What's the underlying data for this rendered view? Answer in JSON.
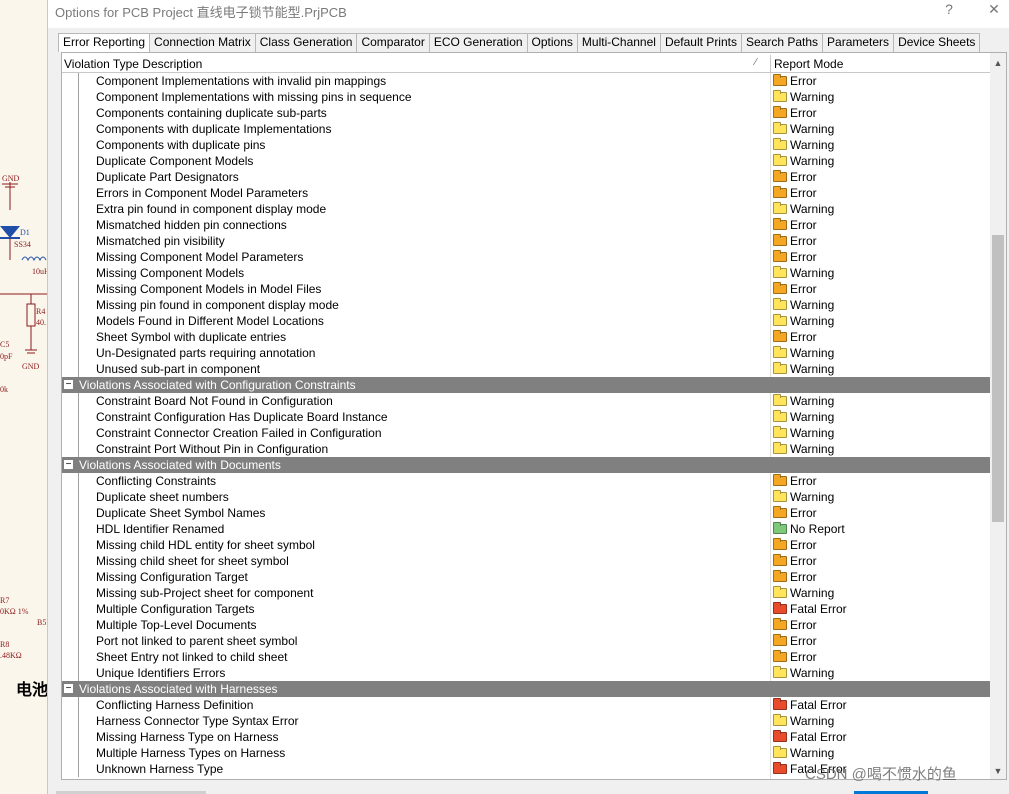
{
  "window": {
    "title": "Options for PCB Project 直线电子锁节能型.PrjPCB",
    "help": "?",
    "close": "✕"
  },
  "tabs": [
    "Error Reporting",
    "Connection Matrix",
    "Class Generation",
    "Comparator",
    "ECO Generation",
    "Options",
    "Multi-Channel",
    "Default Prints",
    "Search Paths",
    "Parameters",
    "Device Sheets"
  ],
  "columns": {
    "description": "Violation Type Description",
    "mode": "Report Mode"
  },
  "mode_colors": {
    "Error": "#f5a623",
    "Warning": "#ffe45c",
    "No Report": "#7ec87a",
    "Fatal Error": "#e84c2a"
  },
  "rows": [
    {
      "kind": "item",
      "text": "Component Implementations with invalid pin mappings",
      "mode": "Error"
    },
    {
      "kind": "item",
      "text": "Component Implementations with missing pins in sequence",
      "mode": "Warning"
    },
    {
      "kind": "item",
      "text": "Components containing duplicate sub-parts",
      "mode": "Error"
    },
    {
      "kind": "item",
      "text": "Components with duplicate Implementations",
      "mode": "Warning"
    },
    {
      "kind": "item",
      "text": "Components with duplicate pins",
      "mode": "Warning"
    },
    {
      "kind": "item",
      "text": "Duplicate Component Models",
      "mode": "Warning"
    },
    {
      "kind": "item",
      "text": "Duplicate Part Designators",
      "mode": "Error"
    },
    {
      "kind": "item",
      "text": "Errors in Component Model Parameters",
      "mode": "Error"
    },
    {
      "kind": "item",
      "text": "Extra pin found in component display mode",
      "mode": "Warning"
    },
    {
      "kind": "item",
      "text": "Mismatched hidden pin connections",
      "mode": "Error"
    },
    {
      "kind": "item",
      "text": "Mismatched pin visibility",
      "mode": "Error"
    },
    {
      "kind": "item",
      "text": "Missing Component Model Parameters",
      "mode": "Error"
    },
    {
      "kind": "item",
      "text": "Missing Component Models",
      "mode": "Warning"
    },
    {
      "kind": "item",
      "text": "Missing Component Models in Model Files",
      "mode": "Error"
    },
    {
      "kind": "item",
      "text": "Missing pin found in component display mode",
      "mode": "Warning"
    },
    {
      "kind": "item",
      "text": "Models Found in Different Model Locations",
      "mode": "Warning"
    },
    {
      "kind": "item",
      "text": "Sheet Symbol with duplicate entries",
      "mode": "Error"
    },
    {
      "kind": "item",
      "text": "Un-Designated parts requiring annotation",
      "mode": "Warning"
    },
    {
      "kind": "item",
      "text": "Unused sub-part in component",
      "mode": "Warning"
    },
    {
      "kind": "group",
      "text": "Violations Associated with Configuration Constraints",
      "toggle": "−"
    },
    {
      "kind": "item",
      "text": "Constraint Board Not Found in Configuration",
      "mode": "Warning"
    },
    {
      "kind": "item",
      "text": "Constraint Configuration Has Duplicate Board Instance",
      "mode": "Warning"
    },
    {
      "kind": "item",
      "text": "Constraint Connector Creation Failed in Configuration",
      "mode": "Warning"
    },
    {
      "kind": "item",
      "text": "Constraint Port Without Pin in Configuration",
      "mode": "Warning"
    },
    {
      "kind": "group",
      "text": "Violations Associated with Documents",
      "toggle": "−"
    },
    {
      "kind": "item",
      "text": "Conflicting Constraints",
      "mode": "Error"
    },
    {
      "kind": "item",
      "text": "Duplicate sheet numbers",
      "mode": "Warning"
    },
    {
      "kind": "item",
      "text": "Duplicate Sheet Symbol Names",
      "mode": "Error"
    },
    {
      "kind": "item",
      "text": "HDL Identifier Renamed",
      "mode": "No Report"
    },
    {
      "kind": "item",
      "text": "Missing child HDL entity for sheet symbol",
      "mode": "Error"
    },
    {
      "kind": "item",
      "text": "Missing child sheet for sheet symbol",
      "mode": "Error"
    },
    {
      "kind": "item",
      "text": "Missing Configuration Target",
      "mode": "Error"
    },
    {
      "kind": "item",
      "text": "Missing sub-Project sheet for component",
      "mode": "Warning"
    },
    {
      "kind": "item",
      "text": "Multiple Configuration Targets",
      "mode": "Fatal Error"
    },
    {
      "kind": "item",
      "text": "Multiple Top-Level Documents",
      "mode": "Error"
    },
    {
      "kind": "item",
      "text": "Port not linked to parent sheet symbol",
      "mode": "Error"
    },
    {
      "kind": "item",
      "text": "Sheet Entry not linked to child sheet",
      "mode": "Error"
    },
    {
      "kind": "item",
      "text": "Unique Identifiers Errors",
      "mode": "Warning"
    },
    {
      "kind": "group",
      "text": "Violations Associated with Harnesses",
      "toggle": "−"
    },
    {
      "kind": "item",
      "text": "Conflicting Harness Definition",
      "mode": "Fatal Error"
    },
    {
      "kind": "item",
      "text": "Harness Connector Type Syntax Error",
      "mode": "Warning"
    },
    {
      "kind": "item",
      "text": "Missing Harness Type on Harness",
      "mode": "Fatal Error"
    },
    {
      "kind": "item",
      "text": "Multiple Harness Types on Harness",
      "mode": "Warning"
    },
    {
      "kind": "item",
      "text": "Unknown Harness Type",
      "mode": "Fatal Error"
    }
  ],
  "schematic": {
    "gnd1": "GND",
    "d1": "D1",
    "ss34": "SS34",
    "l": "10uH",
    "r4": "R4",
    "r4v": "40.",
    "c5": "C5",
    "c5v": "0pF",
    "gnd2": "GND",
    "k": "0k",
    "r7": "R7",
    "r7v": "0KΩ 1%",
    "r8": "R8",
    "r8v": ".48KΩ",
    "b5": "B5",
    "cn": "电池"
  },
  "watermark": "CSDN @喝不惯水的鱼"
}
